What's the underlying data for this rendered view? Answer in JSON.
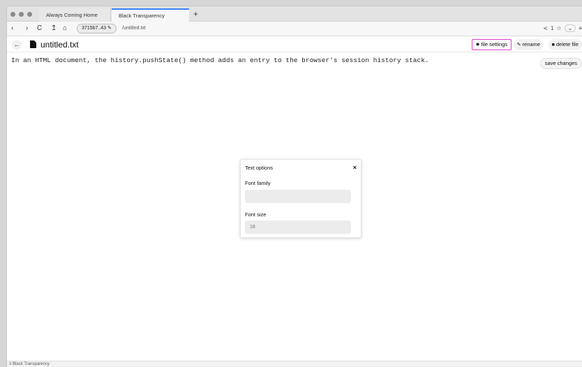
{
  "browser": {
    "tabs": [
      {
        "label": "Always Coming Home",
        "active": false
      },
      {
        "label": "Black Transparency",
        "active": true
      }
    ],
    "new_tab_glyph": "+",
    "nav_glyphs": {
      "back": "‹",
      "forward": "›",
      "reload": "C",
      "up": "↥",
      "home": "⌂"
    },
    "address": {
      "host": "3715b7..43",
      "path": "/untitled.txt"
    },
    "right_nav": {
      "share": "≺",
      "version": "1",
      "bookmark": "☆",
      "dropdown": "⌄",
      "menu": "≡"
    }
  },
  "app_header": {
    "back_glyph": "←",
    "filename": "untitled.txt",
    "buttons": {
      "file_settings": "file settings",
      "rename": "rename",
      "delete_file": "delete file"
    }
  },
  "editor": {
    "content": "In an HTML document, the history.pushState() method adds an entry to the browser's session history stack."
  },
  "save_button": "save changes",
  "modal": {
    "title": "Text options",
    "close_glyph": "×",
    "font_family_label": "Font family",
    "font_family_value": "",
    "font_size_label": "Font size",
    "font_size_placeholder": "18"
  },
  "status_bar": {
    "text": "≡ Black Transparency"
  },
  "colors": {
    "highlight_border": "#e040d0",
    "active_tab_accent": "#3b82f6"
  }
}
